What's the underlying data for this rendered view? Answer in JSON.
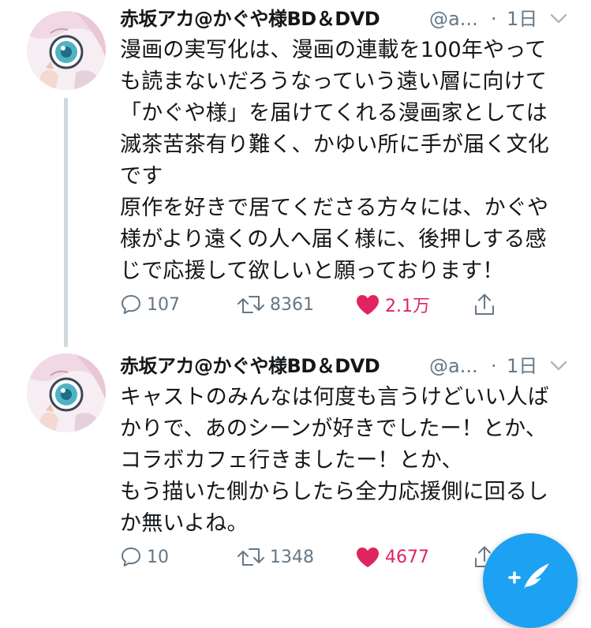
{
  "tweets": [
    {
      "display_name": "赤坂アカ@かぐや様BD＆DVD",
      "handle": "@a...",
      "separator": "·",
      "time": "1日",
      "text_lines": [
        "漫画の実写化は、漫画の連載を100年やって",
        "も読まないだろうなっていう遠い層に向けて",
        "「かぐや様」を届けてくれる漫画家としては",
        "滅茶苦茶有り難く、かゆい所に手が届く文化",
        "です",
        "原作を好きで居てくださる方々には、かぐや",
        "様がより遠くの人へ届く様に、後押しする感",
        "じで応援して欲しいと願っております！"
      ],
      "replies": "107",
      "retweets": "8361",
      "likes": "2.1万",
      "liked": true
    },
    {
      "display_name": "赤坂アカ@かぐや様BD＆DVD",
      "handle": "@a...",
      "separator": "·",
      "time": "1日",
      "text_lines": [
        "キャストのみんなは何度も言うけどいい人ば",
        "かりで、あのシーンが好きでしたー！とか、",
        "コラボカフェ行きましたー！とか、",
        "もう描いた側からしたら全力応援側に回るし",
        "か無いよね。"
      ],
      "replies": "10",
      "retweets": "1348",
      "likes": "4677",
      "liked": true
    }
  ],
  "icons": {
    "reply": "reply-icon",
    "retweet": "retweet-icon",
    "like": "heart-icon",
    "share": "share-icon",
    "caret": "chevron-down-icon",
    "compose": "compose-tweet-icon"
  },
  "colors": {
    "text": "#14171a",
    "muted": "#657786",
    "like": "#e0245e",
    "accent": "#1da1f2",
    "thread_line": "#cfd9de"
  }
}
